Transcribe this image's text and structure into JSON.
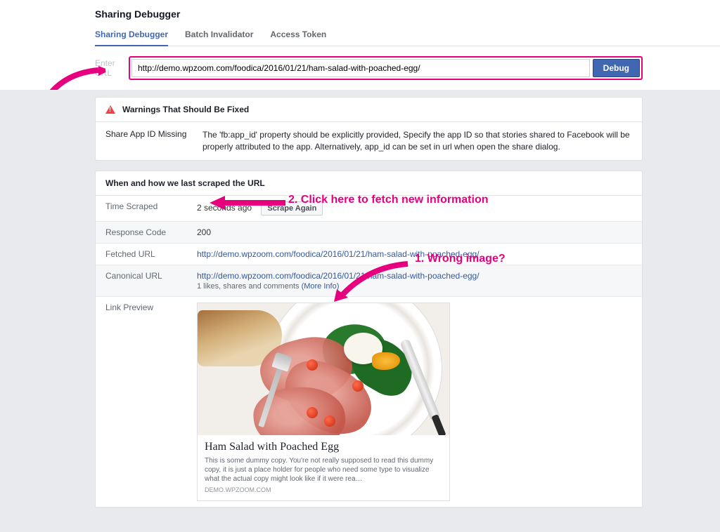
{
  "header": {
    "title": "Sharing Debugger",
    "tabs": [
      "Sharing Debugger",
      "Batch Invalidator",
      "Access Token"
    ]
  },
  "urlbar": {
    "label": "Enter URL",
    "value": "http://demo.wpzoom.com/foodica/2016/01/21/ham-salad-with-poached-egg/",
    "debug_label": "Debug"
  },
  "warnings": {
    "panel_title": "Warnings That Should Be Fixed",
    "items": [
      {
        "key": "Share App ID Missing",
        "val": "The 'fb:app_id' property should be explicitly provided, Specify the app ID so that stories shared to Facebook will be properly attributed to the app. Alternatively, app_id can be set in url when open the share dialog."
      }
    ]
  },
  "scrape": {
    "panel_title": "When and how we last scraped the URL",
    "scrape_again_label": "Scrape Again",
    "rows": {
      "time_scraped_key": "Time Scraped",
      "time_scraped_val": "2 seconds ago",
      "response_code_key": "Response Code",
      "response_code_val": "200",
      "fetched_url_key": "Fetched URL",
      "fetched_url_val": "http://demo.wpzoom.com/foodica/2016/01/21/ham-salad-with-poached-egg/",
      "canonical_url_key": "Canonical URL",
      "canonical_url_val": "http://demo.wpzoom.com/foodica/2016/01/21/ham-salad-with-poached-egg/",
      "likes_text": "1 likes, shares and comments ",
      "more_info": "(More Info)",
      "link_preview_key": "Link Preview"
    }
  },
  "preview": {
    "title": "Ham Salad with Poached Egg",
    "desc": "This is some dummy copy. You're not really supposed to read this dummy copy, it is just a place holder for people who need some type to visualize what the actual copy might look like if it were rea…",
    "domain": "DEMO.WPZOOM.COM"
  },
  "annotations": {
    "a1": "1. Wrong image?",
    "a2": "2. Click here to fetch new information"
  }
}
